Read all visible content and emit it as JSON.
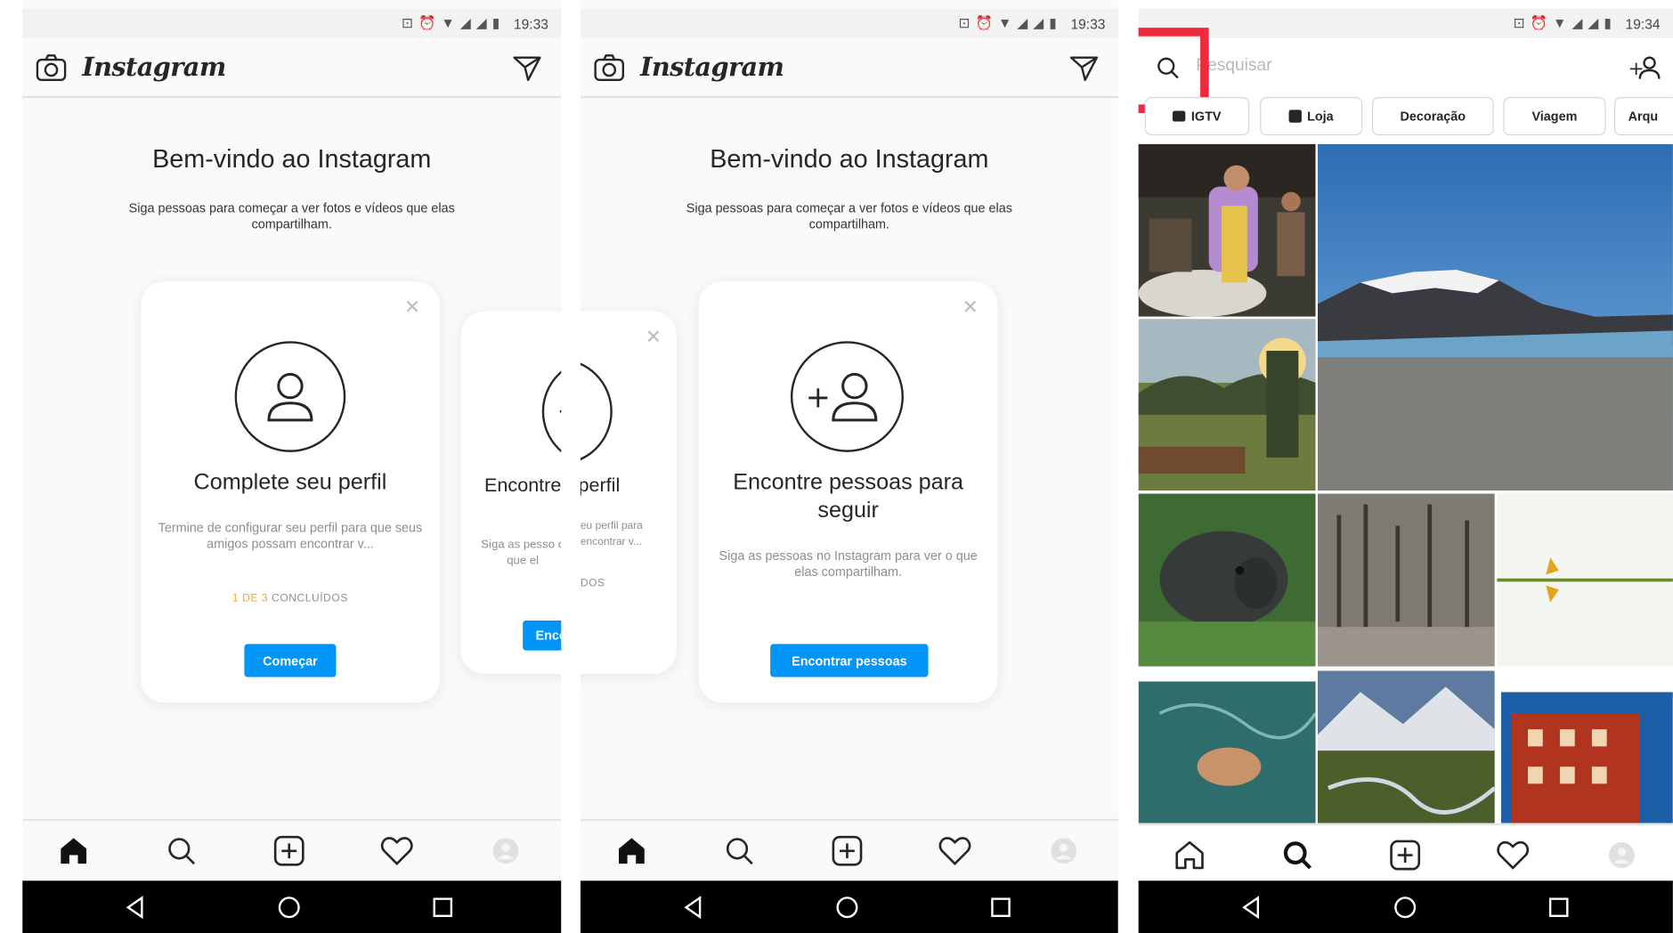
{
  "status": {
    "time_1": "19:33",
    "time_2": "19:33",
    "time_3": "19:34",
    "icons": [
      "vibrate-icon",
      "alarm-icon",
      "wifi-icon",
      "signal-icon",
      "signal-icon",
      "battery-icon"
    ]
  },
  "app": {
    "logo": "Instagram"
  },
  "welcome": {
    "title": "Bem-vindo ao Instagram",
    "subtitle": "Siga pessoas para começar a ver fotos e vídeos que elas compartilham."
  },
  "cards": {
    "profile": {
      "title": "Complete seu perfil",
      "desc": "Termine de configurar seu perfil para que seus amigos possam encontrar v...",
      "progress_count": "1 DE 3",
      "progress_label": "CONCLUÍDOS",
      "button": "Começar"
    },
    "find": {
      "title": "Encontre pessoas para seguir",
      "desc": "Siga as pessoas no Instagram para ver o que elas compartilham.",
      "button": "Encontrar pessoas"
    },
    "partial_next": {
      "title": "Encontre",
      "desc": "Siga as pesso o que el",
      "button": "Enco"
    },
    "partial_prev": {
      "title": "perfil",
      "desc": "eu perfil para encontrar v...",
      "progress": "DOS"
    }
  },
  "explore": {
    "search_placeholder": "Pesquisar",
    "chips": [
      {
        "label": "IGTV",
        "icon": "igtv-icon"
      },
      {
        "label": "Loja",
        "icon": "shop-bag-icon"
      },
      {
        "label": "Decoração",
        "icon": ""
      },
      {
        "label": "Viagem",
        "icon": ""
      },
      {
        "label": "Arqu",
        "icon": ""
      }
    ]
  },
  "colors": {
    "accent": "#0095f6",
    "highlight_box": "#ee2b3d",
    "progress_highlight": "#f5a623"
  }
}
